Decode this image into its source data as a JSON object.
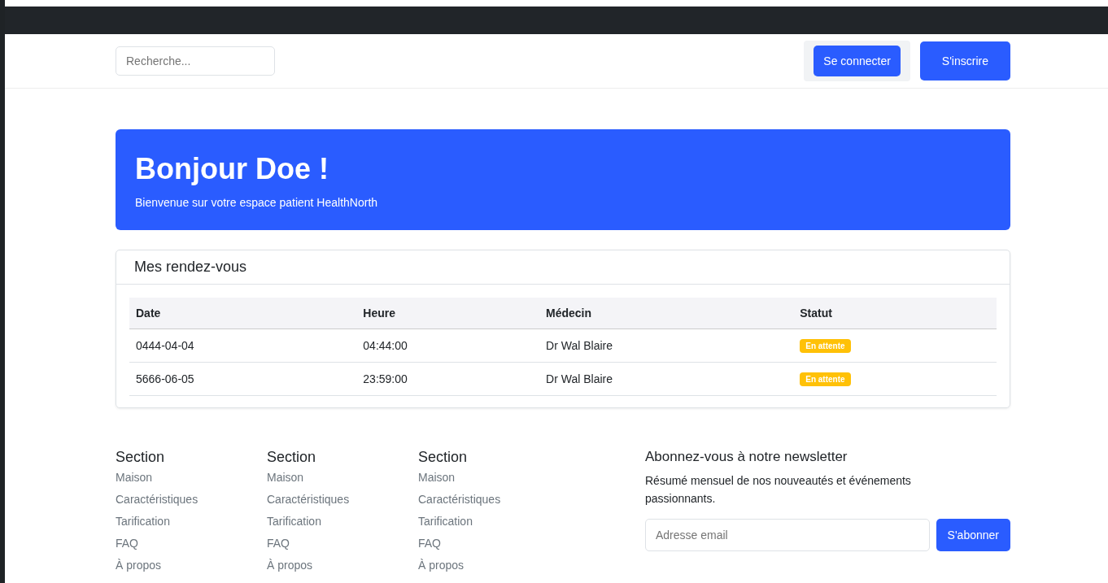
{
  "navbar": {
    "search": {
      "placeholder": "Recherche..."
    },
    "buttons": [
      {
        "label": "Se connecter",
        "kind": "login"
      },
      {
        "label": "S'inscrire",
        "kind": "signup"
      }
    ]
  },
  "hero": {
    "title": "Bonjour Doe !",
    "subtitle": "Bienvenue sur votre espace patient HealthNorth"
  },
  "appointments": {
    "title": "Mes rendez-vous",
    "columns": [
      "Date",
      "Heure",
      "Médecin",
      "Statut"
    ],
    "rows": [
      {
        "date": "0444-04-04",
        "time": "04:44:00",
        "doctor": "Dr Wal Blaire",
        "status": "En attente",
        "color": "#ffc107"
      },
      {
        "date": "5666-06-05",
        "time": "23:59:00",
        "doctor": "Dr Wal Blaire",
        "status": "En attente",
        "color": "#ffc107"
      }
    ]
  },
  "footer": {
    "sections": [
      {
        "title": "Section",
        "links": [
          "Maison",
          "Caractéristiques",
          "Tarification",
          "FAQ",
          "À propos"
        ]
      },
      {
        "title": "Section",
        "links": [
          "Maison",
          "Caractéristiques",
          "Tarification",
          "FAQ",
          "À propos"
        ]
      },
      {
        "title": "Section",
        "links": [
          "Maison",
          "Caractéristiques",
          "Tarification",
          "FAQ",
          "À propos"
        ]
      }
    ],
    "newsletter": {
      "title": "Abonnez-vous à notre newsletter",
      "text": "Résumé mensuel de nos nouveautés et événements passionnants.",
      "email_placeholder": "Adresse email",
      "button": "S'abonner"
    }
  }
}
